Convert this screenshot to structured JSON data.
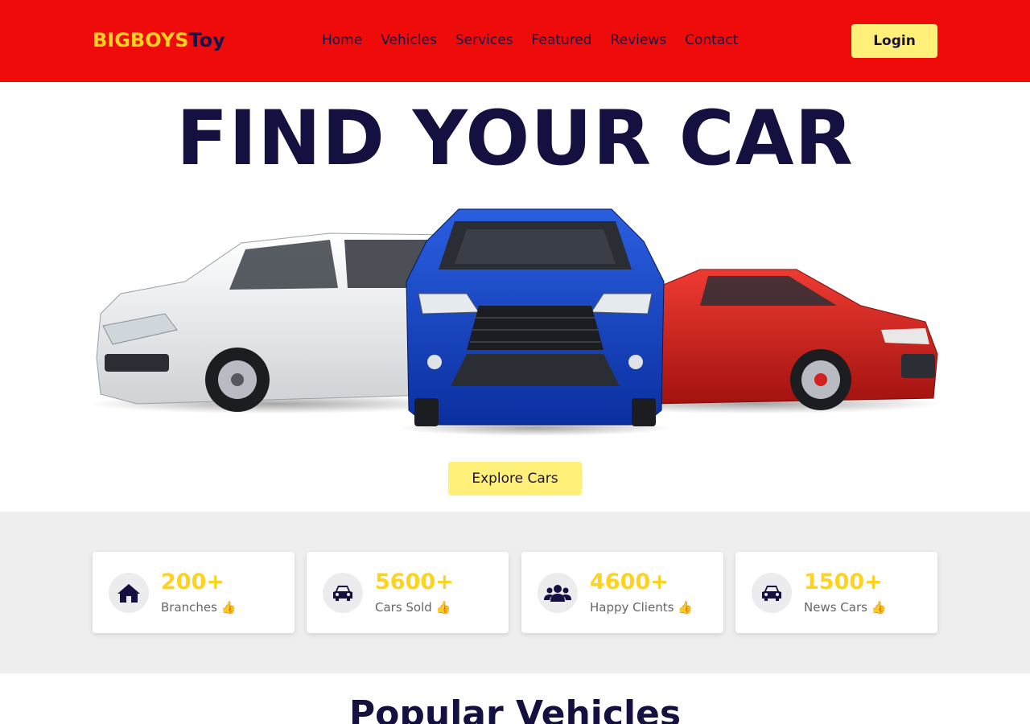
{
  "brand": {
    "part1": "BIGBOYS",
    "part2": "Toy"
  },
  "nav": {
    "items": [
      "Home",
      "Vehicles",
      "Services",
      "Featured",
      "Reviews",
      "Contact"
    ]
  },
  "header": {
    "login_label": "Login"
  },
  "hero": {
    "title": "FIND YOUR CAR",
    "cta_label": "Explore Cars",
    "image_alt": "three cars: white SUV, blue SUV, red sedan"
  },
  "stats": [
    {
      "value": "200+",
      "label": "Branches 👍",
      "icon": "home-icon"
    },
    {
      "value": "5600+",
      "label": "Cars Sold 👍",
      "icon": "car-icon"
    },
    {
      "value": "4600+",
      "label": "Happy Clients 👍",
      "icon": "users-icon"
    },
    {
      "value": "1500+",
      "label": "News Cars 👍",
      "icon": "car-icon"
    }
  ],
  "popular": {
    "title": "Popular Vehicles"
  },
  "colors": {
    "header_bg": "#f00b0b",
    "accent_yellow": "#ffd21e",
    "button_yellow": "#fff07a",
    "navy": "#14103f",
    "stats_bg": "#eeeeee"
  }
}
